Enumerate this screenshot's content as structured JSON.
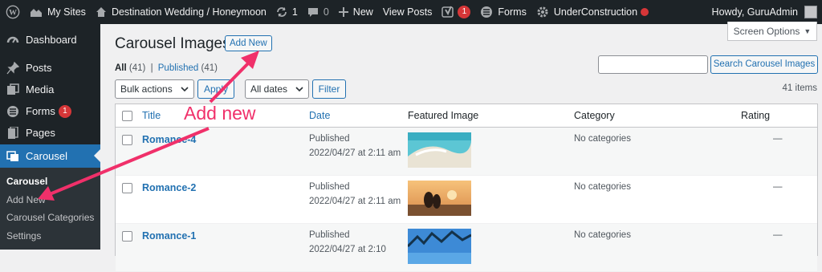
{
  "admin_bar": {
    "my_sites": "My Sites",
    "site_name": "Destination Wedding / Honeymoon",
    "updates_count": "1",
    "comments_count": "0",
    "new_label": "New",
    "view_posts": "View Posts",
    "yoast_count": "1",
    "forms": "Forms",
    "under_construction": "UnderConstruction",
    "howdy": "Howdy, GuruAdmin"
  },
  "sidebar": {
    "items": [
      {
        "label": "Dashboard",
        "icon": "dashboard-icon"
      },
      {
        "label": "Posts",
        "icon": "pin-icon"
      },
      {
        "label": "Media",
        "icon": "media-icon"
      },
      {
        "label": "Forms",
        "icon": "forms-icon",
        "badge": "1"
      },
      {
        "label": "Pages",
        "icon": "pages-icon"
      },
      {
        "label": "Carousel",
        "icon": "carousel-icon"
      }
    ],
    "submenu": [
      "Carousel",
      "Add New",
      "Carousel Categories",
      "Settings"
    ]
  },
  "screen_options": "Screen Options",
  "page": {
    "title": "Carousel Images",
    "add_new": "Add New",
    "all_label": "All",
    "all_count": "(41)",
    "separator": "|",
    "published_label": "Published",
    "published_count": "(41)",
    "search_button": "Search Carousel Images",
    "bulk_actions": "Bulk actions",
    "apply": "Apply",
    "all_dates": "All dates",
    "filter": "Filter",
    "items_count": "41 items"
  },
  "table": {
    "columns": [
      "Title",
      "Date",
      "Featured Image",
      "Category",
      "Rating"
    ],
    "rows": [
      {
        "title": "Romance-4",
        "status": "Published",
        "date": "2022/04/27 at 2:11 am",
        "category": "No categories",
        "rating": "—",
        "image": "beach-aerial"
      },
      {
        "title": "Romance-2",
        "status": "Published",
        "date": "2022/04/27 at 2:11 am",
        "category": "No categories",
        "rating": "—",
        "image": "couple-sunset"
      },
      {
        "title": "Romance-1",
        "status": "Published",
        "date": "2022/04/27 at 2:10",
        "category": "No categories",
        "rating": "—",
        "image": "palm-sky"
      }
    ]
  },
  "annotation": {
    "label": "Add new",
    "color": "#f0306a"
  },
  "colors": {
    "admin_bar": "#1d2327",
    "accent": "#2271b1",
    "badge": "#d63638"
  }
}
